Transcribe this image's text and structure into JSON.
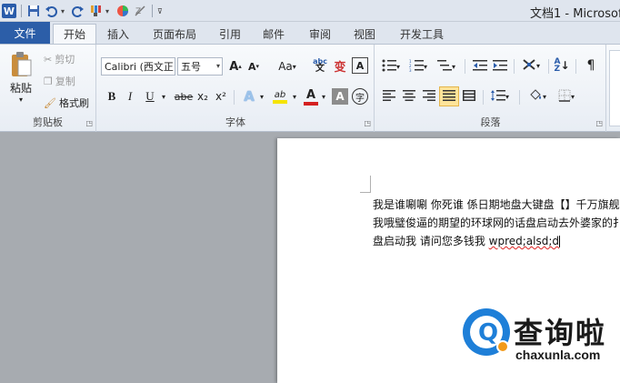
{
  "window": {
    "title": "文档1 - Microsoft"
  },
  "quick_access": {
    "icons": [
      "word-logo-icon",
      "save-icon",
      "undo-icon",
      "redo-icon",
      "format-painter-icon",
      "color-icon",
      "clear-icon",
      "customize-icon"
    ]
  },
  "tabs": {
    "file": "文件",
    "home": "开始",
    "insert": "插入",
    "layout": "页面布局",
    "references": "引用",
    "mailings": "邮件",
    "review": "审阅",
    "view": "视图",
    "developer": "开发工具"
  },
  "clipboard": {
    "group_label": "剪贴板",
    "paste": "粘贴",
    "cut": "剪切",
    "copy": "复制",
    "format_painter": "格式刷"
  },
  "font": {
    "group_label": "字体",
    "font_name": "Calibri (西文正",
    "font_size": "五号",
    "grow": "A",
    "shrink": "A",
    "change_case": "Aa",
    "phonetic": "abc",
    "bold": "B",
    "italic": "I",
    "underline": "U",
    "strikethrough": "abe",
    "subscript": "x₂",
    "superscript": "x²",
    "text_effect": "A",
    "highlight": "ab",
    "font_color": "A",
    "char_shading": "A",
    "enclose": "字"
  },
  "paragraph": {
    "group_label": "段落"
  },
  "document": {
    "lines": [
      "我是谁唰唰 你死谁 係日期地盘大键盘【】千万旗舰",
      "我哦璧俊逼的期望的环球网的话盘启动去外婆家的扌",
      "盘启动我 请问您多钱我 "
    ],
    "misspelled": "wpred;alsd;d"
  },
  "watermark": {
    "cn": "查询啦",
    "en": "chaxunla.com"
  },
  "colors": {
    "file_tab": "#2c5ea8",
    "ribbon_bg": "#eef2f7",
    "workspace": "#a7abb0",
    "highlight_yellow": "#f5e400",
    "font_red": "#d42020",
    "watermark_blue": "#1e7fd8",
    "watermark_orange": "#f29a1a"
  }
}
